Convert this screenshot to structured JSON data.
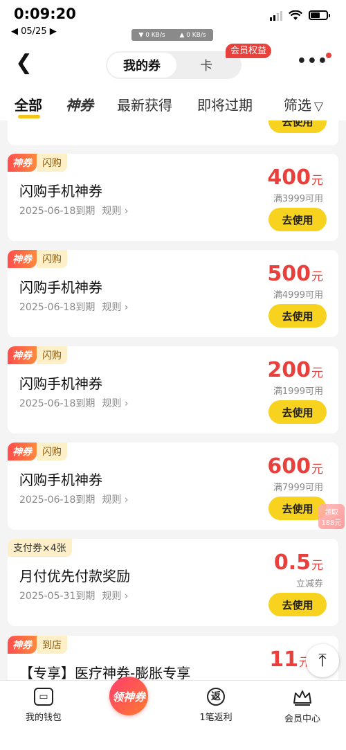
{
  "status": {
    "time": "0:09:20",
    "date": "◀ 05/25 ▶",
    "down_speed": "▼ 0 KB/s",
    "up_speed": "▲ 0 KB/s"
  },
  "header": {
    "segment_active": "我的券",
    "segment_other": "卡",
    "vip_badge": "会员权益"
  },
  "tabs": [
    {
      "label": "全部"
    },
    {
      "label": "神券"
    },
    {
      "label": "最新获得"
    },
    {
      "label": "即将过期"
    },
    {
      "label": "筛选"
    }
  ],
  "partial_card": {
    "button": "去使用"
  },
  "coupons": [
    {
      "tag_brand": "神券",
      "tag_type": "闪购",
      "title": "闪购手机神券",
      "expiry": "2025-06-18到期",
      "rule": "规则 ›",
      "amount": "400",
      "unit": "元",
      "condition": "满3999可用",
      "button": "去使用"
    },
    {
      "tag_brand": "神券",
      "tag_type": "闪购",
      "title": "闪购手机神券",
      "expiry": "2025-06-18到期",
      "rule": "规则 ›",
      "amount": "500",
      "unit": "元",
      "condition": "满4999可用",
      "button": "去使用"
    },
    {
      "tag_brand": "神券",
      "tag_type": "闪购",
      "title": "闪购手机神券",
      "expiry": "2025-06-18到期",
      "rule": "规则 ›",
      "amount": "200",
      "unit": "元",
      "condition": "满1999可用",
      "button": "去使用"
    },
    {
      "tag_brand": "神券",
      "tag_type": "闪购",
      "title": "闪购手机神券",
      "expiry": "2025-06-18到期",
      "rule": "规则 ›",
      "amount": "600",
      "unit": "元",
      "condition": "满7999可用",
      "button": "去使用"
    }
  ],
  "pay_coupon": {
    "tag": "支付券×4张",
    "title": "月付优先付款奖励",
    "expiry": "2025-05-31到期",
    "rule": "规则 ›",
    "amount": "0.5",
    "unit": "元",
    "condition": "立减券",
    "button": "去使用"
  },
  "last_coupon": {
    "tag_brand": "神券",
    "tag_type": "到店",
    "title": "【专享】医疗神券-膨胀专享",
    "amount": "11",
    "unit": "元"
  },
  "float_widget": {
    "line1": "领取",
    "line2": "188元"
  },
  "bottom_nav": [
    {
      "label": "我的钱包",
      "icon": "wallet-icon"
    },
    {
      "label": "领神券",
      "icon": "center-button"
    },
    {
      "label": "1笔返利",
      "icon": "rebate-icon",
      "icon_char": "返"
    },
    {
      "label": "会员中心",
      "icon": "crown-icon"
    }
  ]
}
